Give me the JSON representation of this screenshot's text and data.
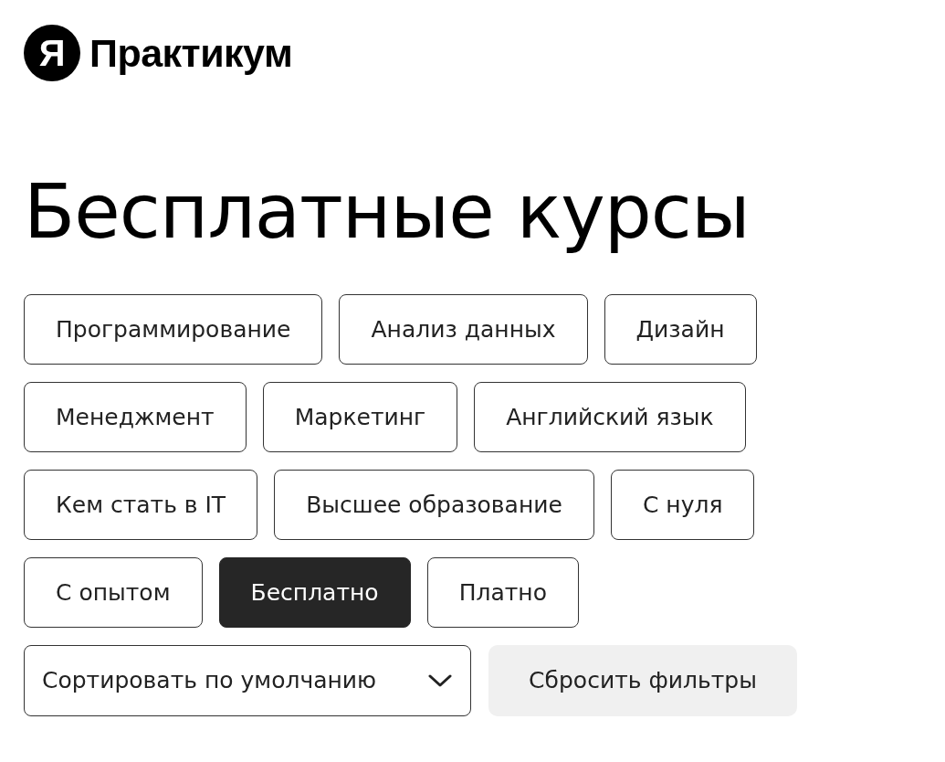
{
  "logo": {
    "mark": "Я",
    "name": "Практикум"
  },
  "title": "Бесплатные курсы",
  "filters": [
    {
      "label": "Программирование",
      "selected": false
    },
    {
      "label": "Анализ данных",
      "selected": false
    },
    {
      "label": "Дизайн",
      "selected": false
    },
    {
      "label": "Менеджмент",
      "selected": false
    },
    {
      "label": "Маркетинг",
      "selected": false
    },
    {
      "label": "Английский язык",
      "selected": false
    },
    {
      "label": "Кем стать в IT",
      "selected": false
    },
    {
      "label": "Высшее образование",
      "selected": false
    },
    {
      "label": "С нуля",
      "selected": false
    },
    {
      "label": "С опытом",
      "selected": false
    },
    {
      "label": "Бесплатно",
      "selected": true
    },
    {
      "label": "Платно",
      "selected": false
    }
  ],
  "sort": {
    "value": "Сортировать по умолчанию"
  },
  "reset_button": {
    "label": "Сбросить фильтры"
  }
}
